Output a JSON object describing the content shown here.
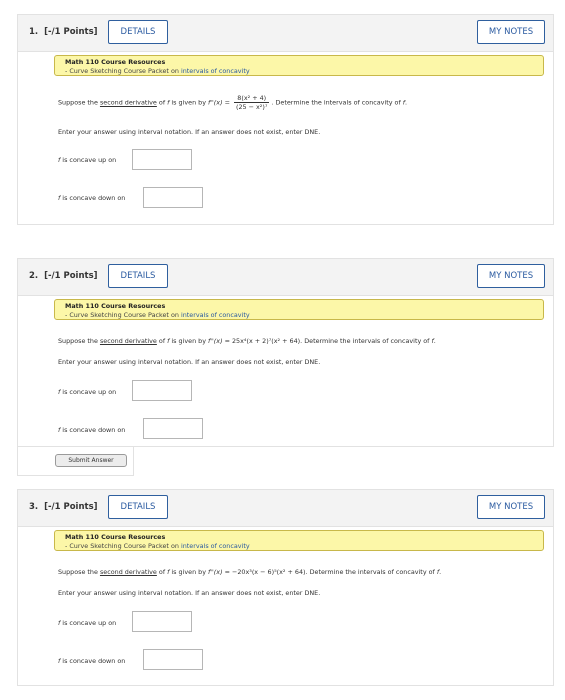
{
  "details_label": "DETAILS",
  "notes_label": "MY NOTES",
  "resources": {
    "title": "Math 110 Course Resources",
    "subtitle_prefix": "- Curve Sketching Course Packet on ",
    "link": "intervals of concavity"
  },
  "instruction": "Enter your answer using interval notation. If an answer does not exist, enter DNE.",
  "concave_up_label": "is concave up on",
  "concave_down_label": "is concave down on",
  "submit_label": "Submit Answer",
  "text": {
    "suppose": "Suppose the ",
    "second_derivative": "second derivative",
    "of": " of ",
    "f": "f",
    "given_by": " is given by ",
    "fpp": "f''(x) = ",
    "determine": "Determine the intervals of concavity of "
  },
  "questions": [
    {
      "number": "1.",
      "points": "[-/1 Points]",
      "formula_numerator": "8(x² + 4)",
      "formula_denominator": "(25 − x²)⁷"
    },
    {
      "number": "2.",
      "points": "[-/1 Points]",
      "formula": "25x⁴(x + 2)⁷(x² + 64)"
    },
    {
      "number": "3.",
      "points": "[-/1 Points]",
      "formula": "−20x³(x − 6)⁵(x² + 64)"
    }
  ]
}
